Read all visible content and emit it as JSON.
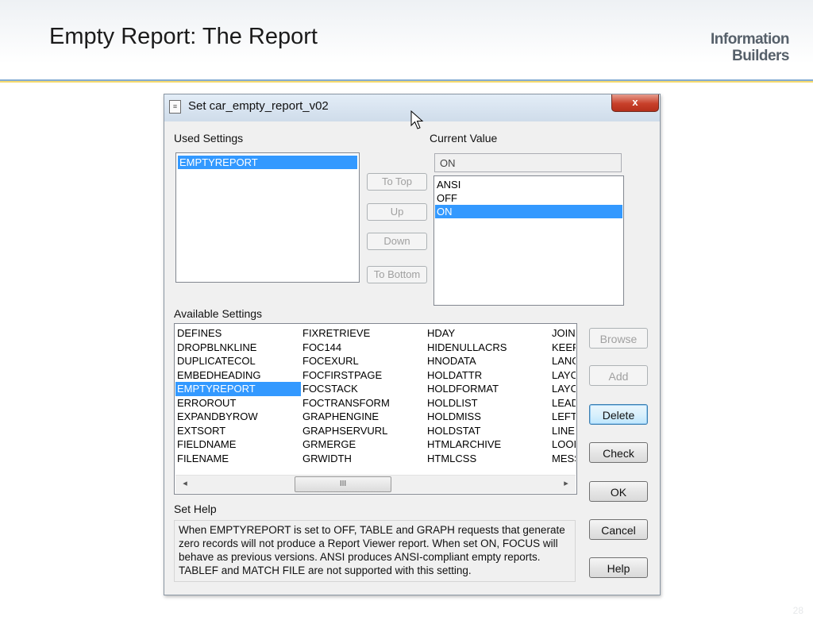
{
  "slide": {
    "title": "Empty Report: The Report",
    "logo_line1": "Information",
    "logo_line2": "Builders",
    "page_number": "28",
    "accent_color": "#f0c419"
  },
  "dialog": {
    "title": "Set car_empty_report_v02",
    "close_label": "x",
    "used_settings_label": "Used Settings",
    "used_settings_items": [
      "EMPTYREPORT"
    ],
    "used_settings_selected": "EMPTYREPORT",
    "current_value_label": "Current Value",
    "current_value": "ON",
    "value_options": [
      "ANSI",
      "OFF",
      "ON"
    ],
    "value_selected": "ON",
    "move_buttons": {
      "to_top": "To Top",
      "up": "Up",
      "down": "Down",
      "to_bottom": "To Bottom"
    },
    "available_settings_label": "Available Settings",
    "available_columns": [
      [
        "DEFINES",
        "DROPBLNKLINE",
        "DUPLICATECOL",
        "EMBEDHEADING",
        "EMPTYREPORT",
        "ERROROUT",
        "EXPANDBYROW",
        "EXTSORT",
        "FIELDNAME",
        "FILENAME"
      ],
      [
        "FIXRETRIEVE",
        "FOC144",
        "FOCEXURL",
        "FOCFIRSTPAGE",
        "FOCSTACK",
        "FOCTRANSFORM",
        "GRAPHENGINE",
        "GRAPHSERVURL",
        "GRMERGE",
        "GRWIDTH"
      ],
      [
        "HDAY",
        "HIDENULLACRS",
        "HNODATA",
        "HOLDATTR",
        "HOLDFORMAT",
        "HOLDLIST",
        "HOLDMISS",
        "HOLDSTAT",
        "HTMLARCHIVE",
        "HTMLCSS"
      ],
      [
        "JOIN",
        "KEEP",
        "LANG",
        "LAYO",
        "LAYO",
        "LEAD",
        "LEFT",
        "LINE",
        "LOOI",
        "MESS"
      ]
    ],
    "available_selected": "EMPTYREPORT",
    "side_buttons": {
      "browse": "Browse",
      "add": "Add",
      "delete": "Delete",
      "check": "Check",
      "ok": "OK",
      "cancel": "Cancel",
      "help": "Help"
    },
    "scroll_thumb_grip": "III",
    "set_help_label": "Set Help",
    "help_text": "When EMPTYREPORT is set to OFF, TABLE and GRAPH requests that generate zero records will not produce a Report Viewer report. When set ON, FOCUS will behave as previous versions. ANSI produces ANSI-compliant empty reports. TABLEF and MATCH FILE are not supported with this setting."
  }
}
